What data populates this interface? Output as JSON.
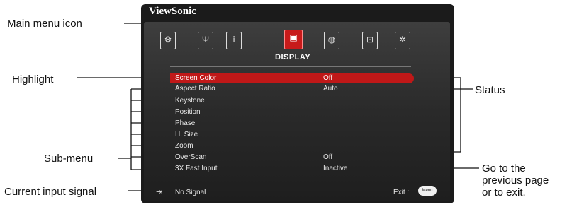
{
  "callouts": {
    "main_menu_icon": "Main menu icon",
    "highlight": "Highlight",
    "sub_menu": "Sub-menu",
    "current_input_signal": "Current input signal",
    "status": "Status",
    "go_back_line1": "Go to the",
    "go_back_line2": "previous page",
    "go_back_line3": "or to exit."
  },
  "osd": {
    "brand": "ViewSonic",
    "menu_icons": [
      "gear-icon",
      "wrench-icon",
      "info-icon",
      "display-icon",
      "globe-icon",
      "input-icon",
      "settings-icon"
    ],
    "active_menu": "DISPLAY",
    "items": [
      {
        "label": "Screen Color",
        "value": "Off"
      },
      {
        "label": "Aspect Ratio",
        "value": "Auto"
      },
      {
        "label": "Keystone",
        "value": ""
      },
      {
        "label": "Position",
        "value": ""
      },
      {
        "label": "Phase",
        "value": ""
      },
      {
        "label": "H. Size",
        "value": ""
      },
      {
        "label": "Zoom",
        "value": ""
      },
      {
        "label": "OverScan",
        "value": "Off"
      },
      {
        "label": "3X Fast Input",
        "value": "Inactive"
      }
    ],
    "signal": "No Signal",
    "exit_label": "Exit :",
    "exit_button": "Menu"
  }
}
